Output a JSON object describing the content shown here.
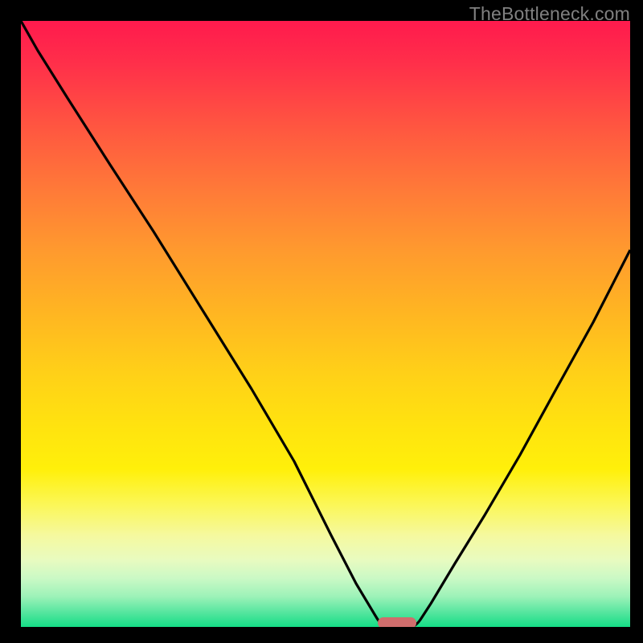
{
  "watermark": "TheBottleneck.com",
  "colors": {
    "frame": "#000000",
    "curve": "#000000",
    "marker": "#cf6d6c",
    "gradient_top": "#ff1a4d",
    "gradient_bottom": "#15dd86"
  },
  "chart_data": {
    "type": "line",
    "title": "",
    "xlabel": "",
    "ylabel": "",
    "xlim": [
      0,
      100
    ],
    "ylim": [
      0,
      100
    ],
    "grid": false,
    "series": [
      {
        "name": "bottleneck-curve",
        "x": [
          0,
          3,
          8,
          15,
          22,
          30,
          38,
          45,
          51,
          55,
          58,
          60,
          62,
          64,
          67,
          71,
          76,
          82,
          88,
          94,
          100
        ],
        "values": [
          100,
          95,
          87,
          76,
          65,
          52,
          39,
          27,
          15,
          7,
          2,
          0,
          0,
          1,
          4,
          10,
          18,
          28,
          39,
          50,
          62
        ]
      }
    ],
    "marker": {
      "x_center": 61.5,
      "width_pct": 5.5,
      "y": 0
    },
    "legend": {
      "visible": false
    }
  }
}
